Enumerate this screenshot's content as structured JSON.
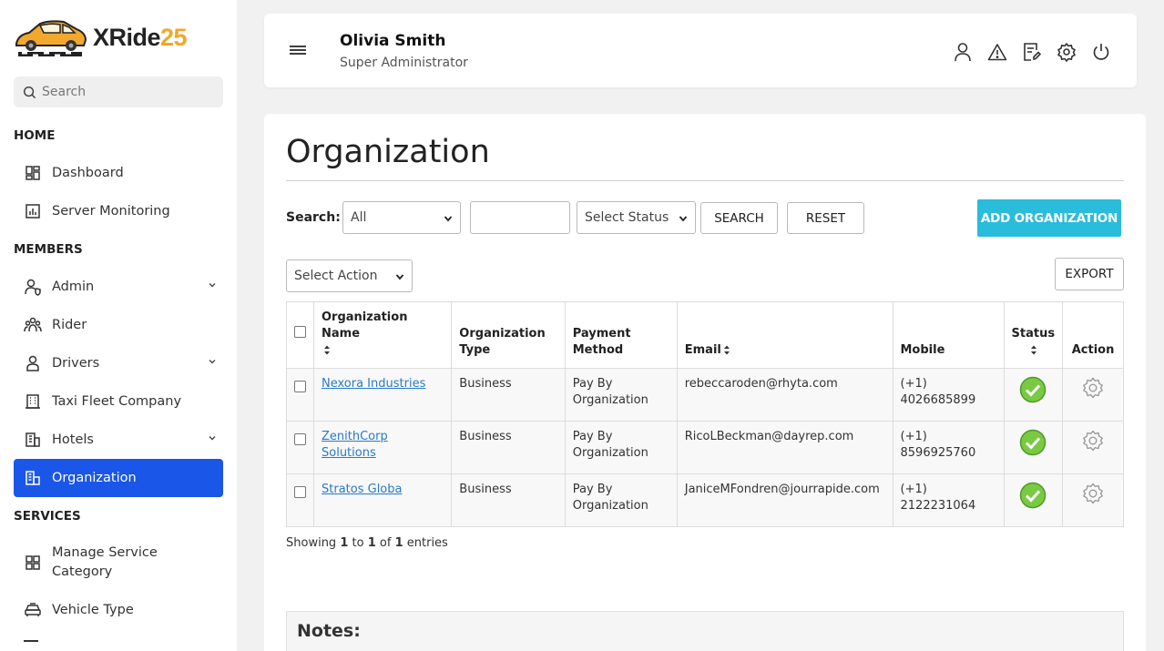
{
  "brand": {
    "name_part1": "XRide",
    "name_part2": "25",
    "accent": "#f2a72d"
  },
  "sidebar": {
    "search_placeholder": "Search",
    "sections": {
      "home": "HOME",
      "members": "MEMBERS",
      "services": "SERVICES"
    },
    "items": [
      {
        "label": "Dashboard",
        "icon": "dashboard-icon"
      },
      {
        "label": "Server Monitoring",
        "icon": "chart-icon"
      },
      {
        "label": "Admin",
        "icon": "user-shield-icon",
        "expandable": true
      },
      {
        "label": "Rider",
        "icon": "users-icon"
      },
      {
        "label": "Drivers",
        "icon": "user-icon",
        "expandable": true
      },
      {
        "label": "Taxi Fleet Company",
        "icon": "building-icon"
      },
      {
        "label": "Hotels",
        "icon": "hotel-icon",
        "expandable": true
      },
      {
        "label": "Organization",
        "icon": "organization-icon",
        "active": true
      },
      {
        "label": "Manage Service Category",
        "icon": "grid-icon"
      },
      {
        "label": "Vehicle Type",
        "icon": "car-icon"
      }
    ],
    "active_color": "#1a56e8"
  },
  "header": {
    "user_name": "Olivia Smith",
    "user_role": "Super Administrator"
  },
  "main": {
    "title": "Organization",
    "filters": {
      "search_label": "Search:",
      "field_select": "All",
      "text_value": "",
      "status_select": "Select Status",
      "search_button": "SEARCH",
      "reset_button": "RESET",
      "add_button": "ADD ORGANIZATION"
    },
    "action_select": "Select Action",
    "export_button": "EXPORT",
    "table": {
      "headers": {
        "name": "Organization Name",
        "type": "Organization Type",
        "payment": "Payment Method",
        "email": "Email",
        "mobile": "Mobile",
        "status": "Status",
        "action": "Action"
      },
      "rows": [
        {
          "name": "Nexora Industries",
          "type": "Business",
          "payment": "Pay By Organization",
          "email": "rebeccaroden@rhyta.com",
          "mobile": "(+1) 4026685899"
        },
        {
          "name": "ZenithCorp Solutions",
          "type": "Business",
          "payment": "Pay By Organization",
          "email": "RicoLBeckman@dayrep.com",
          "mobile": "(+1) 8596925760"
        },
        {
          "name": "Stratos Globa",
          "type": "Business",
          "payment": "Pay By Organization",
          "email": "JaniceMFondren@jourrapide.com",
          "mobile": "(+1) 2122231064"
        }
      ]
    },
    "showing": {
      "prefix": "Showing",
      "from": "1",
      "to_word": "to",
      "to": "1",
      "of_word": "of",
      "total": "1",
      "suffix": "entries"
    },
    "notes_title": "Notes:"
  },
  "colors": {
    "add_button": "#29bcdb",
    "link": "#2a7ac7",
    "status_ok": "#7ac943"
  }
}
